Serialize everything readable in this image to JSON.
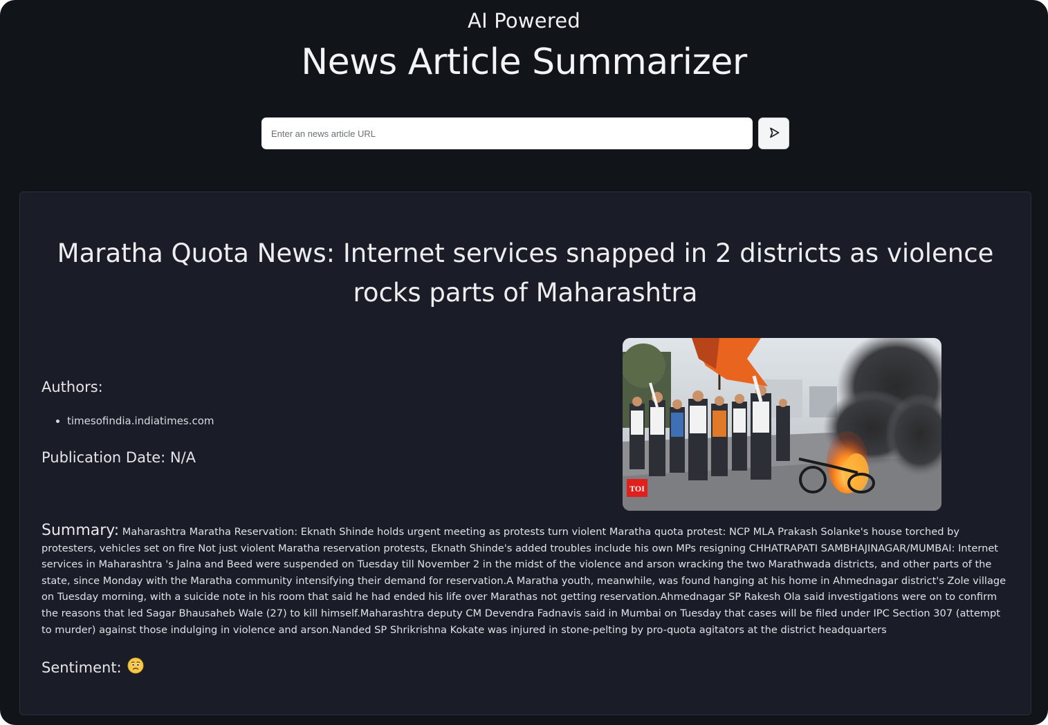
{
  "header": {
    "kicker": "AI Powered",
    "title": "News Article Summarizer"
  },
  "search": {
    "placeholder": "Enter an news article URL",
    "value": "",
    "submit_icon": "send-icon"
  },
  "article": {
    "headline": "Maratha Quota News: Internet services snapped in 2 districts as violence rocks parts of Maharashtra",
    "authors_label": "Authors:",
    "authors": [
      "timesofindia.indiatimes.com"
    ],
    "publication_label": "Publication Date:",
    "publication_date": "N/A",
    "image_watermark": "TOI",
    "summary_label": "Summary:",
    "summary": "Maharashtra Maratha Reservation: Eknath Shinde holds urgent meeting as protests turn violent Maratha quota protest: NCP MLA Prakash Solanke's house torched by protesters, vehicles set on fire Not just violent Maratha reservation protests, Eknath Shinde's added troubles include his own MPs resigning CHHATRAPATI SAMBHAJINAGAR/MUMBAI: Internet services in Maharashtra 's Jalna and Beed were suspended on Tuesday till November 2 in the midst of the violence and arson wracking the two Marathwada districts, and other parts of the state, since Monday with the Maratha community intensifying their demand for reservation.A Maratha youth, meanwhile, was found hanging at his home in Ahmednagar district's Zole village on Tuesday morning, with a suicide note in his room that said he had ended his life over Marathas not getting reservation.Ahmednagar SP Rakesh Ola said investigations were on to confirm the reasons that led Sagar Bhausaheb Wale (27) to kill himself.Maharashtra deputy CM Devendra Fadnavis said in Mumbai on Tuesday that cases will be filed under IPC Section 307 (attempt to murder) against those indulging in violence and arson.Nanded SP Shrikrishna Kokate was injured in stone-pelting by pro-quota agitators at the district headquarters",
    "sentiment_label": "Sentiment:",
    "sentiment_icon": "worried-face-emoji"
  },
  "colors": {
    "page_bg": "#111418",
    "card_bg": "#1a1d27",
    "text": "#e6e8ea",
    "fire": "#e8611a",
    "flag": "#e8641f"
  }
}
